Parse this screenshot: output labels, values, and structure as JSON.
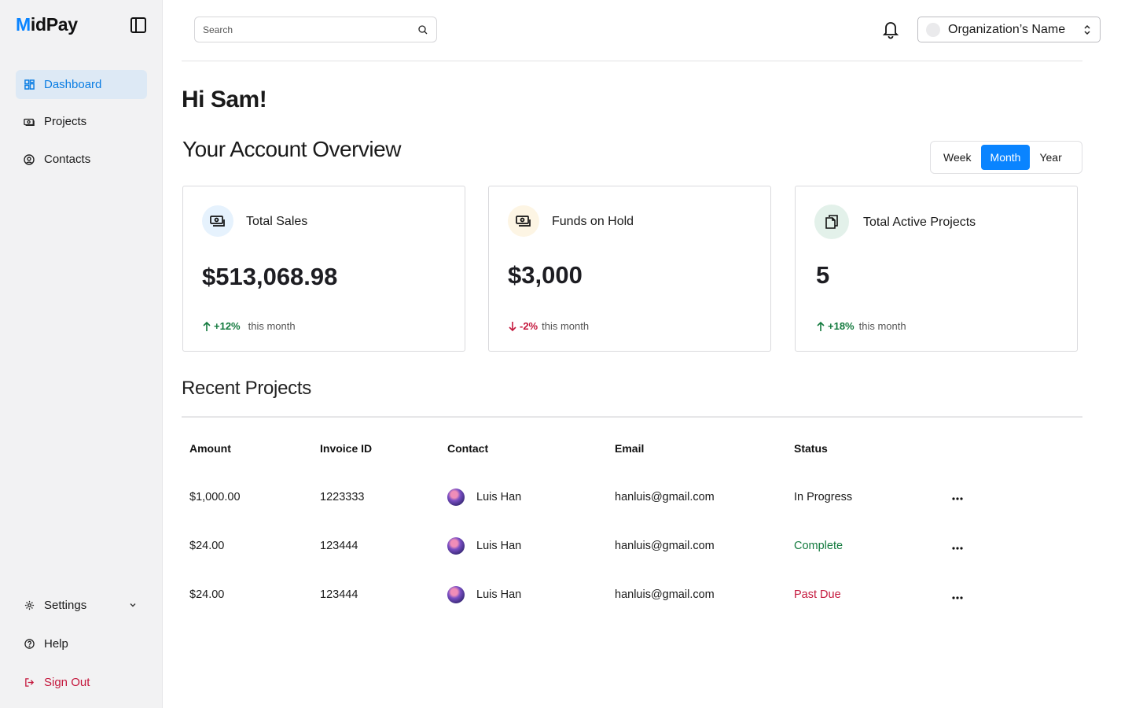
{
  "app": {
    "logo_text_m": "M",
    "logo_text_rest": "idPay"
  },
  "sidebar": {
    "items": [
      {
        "label": "Dashboard",
        "icon": "dashboard-grid-icon",
        "active": true
      },
      {
        "label": "Projects",
        "icon": "money-icon"
      },
      {
        "label": "Contacts",
        "icon": "user-circle-icon"
      }
    ],
    "bottom_items": [
      {
        "label": "Settings",
        "icon": "gear-icon",
        "has_dropdown": true
      },
      {
        "label": "Help",
        "icon": "question-circle-icon"
      },
      {
        "label": "Sign Out",
        "icon": "sign-out-icon"
      }
    ]
  },
  "header": {
    "search_placeholder": "Search",
    "org_name": "Organization’s Name"
  },
  "main": {
    "greeting": "Hi Sam!",
    "overview_title": "Your Account Overview",
    "period_options": [
      "Week",
      "Month",
      "Year"
    ],
    "period_selected": "Month",
    "cards": [
      {
        "title": "Total Sales",
        "value": "$513,068.98",
        "trend": "+12%",
        "trend_dir": "up",
        "trend_label": "this month",
        "icon": "money-icon",
        "icon_bg": "#e6f2fd"
      },
      {
        "title": "Funds on Hold",
        "value": "$3,000",
        "trend": "-2%",
        "trend_dir": "down",
        "trend_label": "this month",
        "icon": "money-icon",
        "icon_bg": "#fdf5e4"
      },
      {
        "title": "Total Active Projects",
        "value": "5",
        "trend": "+18%",
        "trend_dir": "up",
        "trend_label": "this month",
        "icon": "copy-documents-icon",
        "icon_bg": "#e3f1ea"
      }
    ],
    "recent_title": "Recent Projects",
    "table": {
      "headers": [
        "Amount",
        "Invoice ID",
        "Contact",
        "Email",
        "Status"
      ],
      "rows": [
        {
          "amount": "$1,000.00",
          "invoice": "1223333",
          "contact": "Luis Han",
          "email": "hanluis@gmail.com",
          "status": "In Progress",
          "status_type": "progress"
        },
        {
          "amount": "$24.00",
          "invoice": "123444",
          "contact": "Luis Han",
          "email": "hanluis@gmail.com",
          "status": "Complete",
          "status_type": "complete"
        },
        {
          "amount": "$24.00",
          "invoice": "123444",
          "contact": "Luis Han",
          "email": "hanluis@gmail.com",
          "status": "Past Due",
          "status_type": "pastdue"
        }
      ]
    }
  },
  "colors": {
    "accent": "#0a84ff",
    "positive": "#137a3e",
    "negative": "#c4173c"
  }
}
